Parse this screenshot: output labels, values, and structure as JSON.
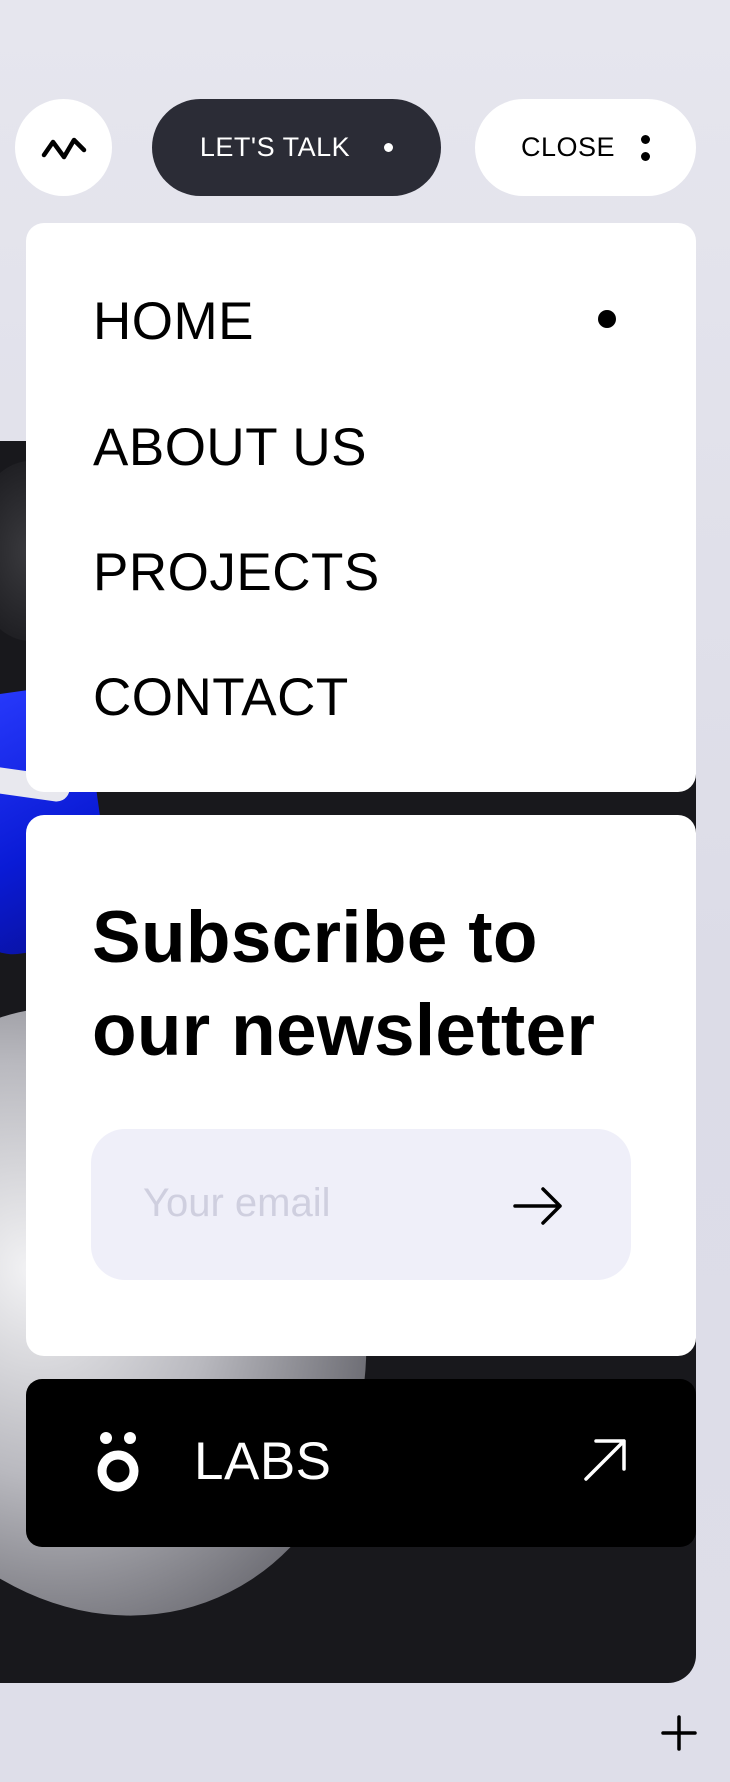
{
  "header": {
    "logo_icon": "wave-icon",
    "talk_label": "LET'S TALK",
    "close_label": "CLOSE",
    "close_icon": "kebab-icon"
  },
  "nav": {
    "items": [
      {
        "label": "HOME",
        "active": true
      },
      {
        "label": "ABOUT US",
        "active": false
      },
      {
        "label": "PROJECTS",
        "active": false
      },
      {
        "label": "CONTACT",
        "active": false
      }
    ]
  },
  "newsletter": {
    "title_line1": "Subscribe to",
    "title_line2": "our newsletter",
    "email_placeholder": "Your email",
    "email_value": "",
    "submit_icon": "arrow-right-icon"
  },
  "labs": {
    "logo_icon": "labs-logo-icon",
    "label": "LABS",
    "link_icon": "arrow-up-right-icon"
  },
  "corner": {
    "icon": "plus-icon"
  },
  "colors": {
    "page_bg": "#e3e3ec",
    "talk_button_bg": "#2b2c36",
    "card_bg": "#ffffff",
    "email_field_bg": "#efeff9",
    "labs_bg": "#000000",
    "hero_dark": "#18181c",
    "hero_blue": "#0a1bd6"
  }
}
